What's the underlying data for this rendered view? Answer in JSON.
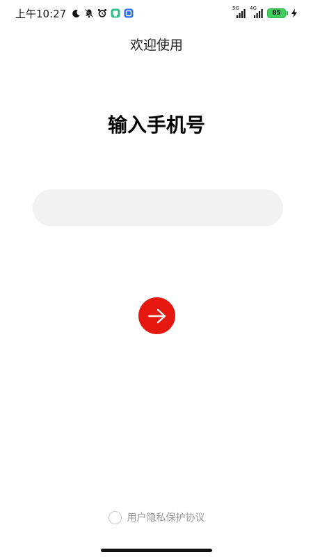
{
  "status_bar": {
    "time": "上午10:27",
    "network_1": "5G",
    "network_2": "4G",
    "battery": "85"
  },
  "header": {
    "title": "欢迎使用"
  },
  "main": {
    "heading": "输入手机号",
    "phone_input": {
      "value": "",
      "placeholder": ""
    },
    "next_button_icon": "arrow-right-icon"
  },
  "footer": {
    "agreement_label": "用户隐私保护协议"
  },
  "colors": {
    "accent": "#e5180f",
    "input_bg": "#f2f2f2",
    "battery": "#3fcf5e"
  }
}
